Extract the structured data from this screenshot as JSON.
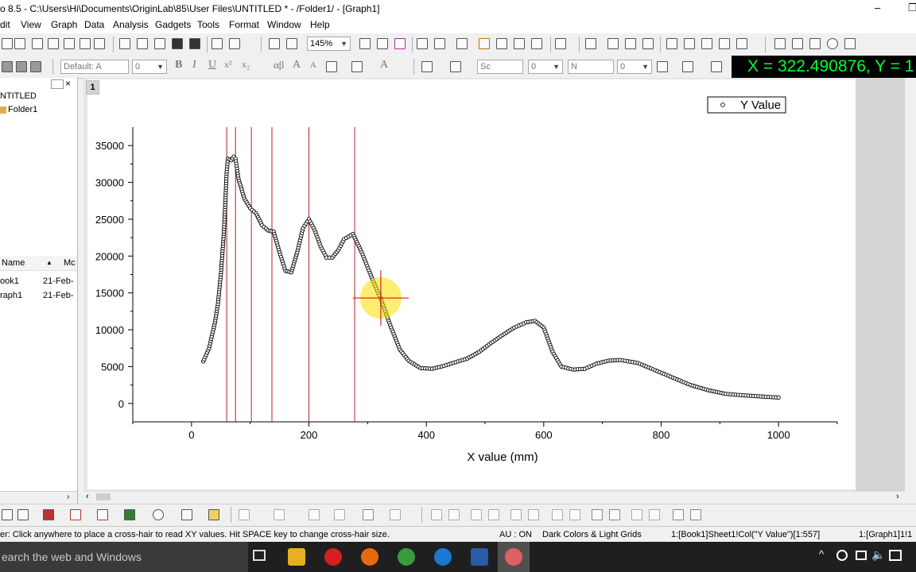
{
  "window": {
    "title": "o 8.5 - C:\\Users\\Hi\\Documents\\OriginLab\\85\\User Files\\UNTITLED * - /Folder1/ - [Graph1]",
    "minimize": "–",
    "restore": "❐"
  },
  "menu": [
    "dit",
    "View",
    "Graph",
    "Data",
    "Analysis",
    "Gadgets",
    "Tools",
    "Format",
    "Window",
    "Help"
  ],
  "toolbar": {
    "zoom_value": "145%",
    "font_combo": "Default: A",
    "size_combo": "0",
    "line_combo": "Sc",
    "line_width": "0",
    "border_combo": "N",
    "border_width": "0",
    "bold": "B",
    "italic": "I",
    "underline": "U",
    "superscript": "x²",
    "subscript": "x₂",
    "greek": "αβ",
    "font_up": "A",
    "font_down": "A",
    "font_color": "A"
  },
  "readout": {
    "text": "X = 322.490876, Y = 1"
  },
  "explorer": {
    "root": "NTITLED",
    "folder": "Folder1",
    "col_name": "Name",
    "col_modified": "Mc",
    "items": [
      {
        "name": "ook1",
        "modified": "21-Feb-"
      },
      {
        "name": "raph1",
        "modified": "21-Feb-"
      }
    ]
  },
  "graph": {
    "layer": "1"
  },
  "chart_data": {
    "type": "scatter",
    "xlabel": "X value (mm)",
    "ylabel": "",
    "xlim": [
      -100,
      1100
    ],
    "ylim": [
      -2500,
      37500
    ],
    "xticks": [
      0,
      200,
      400,
      600,
      800,
      1000
    ],
    "yticks": [
      0,
      5000,
      10000,
      15000,
      20000,
      25000,
      30000,
      35000
    ],
    "legend": {
      "entries": [
        "Y Value"
      ],
      "position": "top-right"
    },
    "series": [
      {
        "name": "Y Value",
        "marker": "open-circle",
        "color": "#000000",
        "points": [
          [
            20,
            5700
          ],
          [
            30,
            7500
          ],
          [
            40,
            11000
          ],
          [
            45,
            13500
          ],
          [
            50,
            17500
          ],
          [
            55,
            23000
          ],
          [
            58,
            28000
          ],
          [
            60,
            31500
          ],
          [
            62,
            33200
          ],
          [
            68,
            33000
          ],
          [
            72,
            33500
          ],
          [
            75,
            33200
          ],
          [
            80,
            30500
          ],
          [
            90,
            27800
          ],
          [
            100,
            26500
          ],
          [
            110,
            25800
          ],
          [
            120,
            24200
          ],
          [
            130,
            23500
          ],
          [
            140,
            23300
          ],
          [
            150,
            20500
          ],
          [
            160,
            18000
          ],
          [
            170,
            17800
          ],
          [
            180,
            20500
          ],
          [
            190,
            23800
          ],
          [
            200,
            25000
          ],
          [
            210,
            23500
          ],
          [
            220,
            21300
          ],
          [
            230,
            19800
          ],
          [
            240,
            19800
          ],
          [
            250,
            20800
          ],
          [
            260,
            22300
          ],
          [
            275,
            23000
          ],
          [
            290,
            20500
          ],
          [
            310,
            16500
          ],
          [
            322,
            14300
          ],
          [
            340,
            10300
          ],
          [
            355,
            7300
          ],
          [
            370,
            5800
          ],
          [
            390,
            4800
          ],
          [
            410,
            4700
          ],
          [
            430,
            5100
          ],
          [
            450,
            5600
          ],
          [
            470,
            6100
          ],
          [
            490,
            7000
          ],
          [
            510,
            8200
          ],
          [
            530,
            9300
          ],
          [
            550,
            10300
          ],
          [
            570,
            11000
          ],
          [
            585,
            11200
          ],
          [
            600,
            10300
          ],
          [
            615,
            7000
          ],
          [
            630,
            5000
          ],
          [
            650,
            4600
          ],
          [
            670,
            4700
          ],
          [
            690,
            5400
          ],
          [
            710,
            5800
          ],
          [
            730,
            5900
          ],
          [
            760,
            5500
          ],
          [
            790,
            4500
          ],
          [
            820,
            3500
          ],
          [
            850,
            2500
          ],
          [
            880,
            1800
          ],
          [
            910,
            1300
          ],
          [
            940,
            1100
          ],
          [
            970,
            950
          ],
          [
            1000,
            800
          ]
        ]
      }
    ],
    "vertical_lines": [
      60,
      75,
      102,
      137,
      200,
      278
    ],
    "crosshair": {
      "x": 322.490876,
      "y": 14300
    }
  },
  "bottom_toolbar": {},
  "status": {
    "hint": "er: Click anywhere to place a cross-hair to read XY values. Hit SPACE key to change cross-hair size.",
    "au": "AU : ON",
    "theme": "Dark Colors & Light Grids",
    "active_column": "1:[Book1]Sheet1!Col(\"Y Value\")[1:557]",
    "active_layer": "1:[Graph1]1!1"
  },
  "taskbar": {
    "search_placeholder": "earch the web and Windows"
  },
  "colors": {
    "readout_bg": "#000000",
    "readout_fg": "#00ff33",
    "vline": "#b22222",
    "crosshair": "#cc0000",
    "highlight": "#f8e000"
  }
}
